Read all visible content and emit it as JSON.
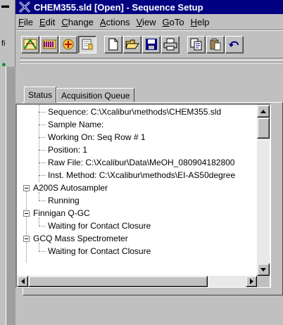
{
  "desktop": {
    "fragments": [
      "fi"
    ]
  },
  "window": {
    "title": "CHEM355.sld [Open] - Sequence Setup",
    "title_color": "#000080"
  },
  "menu": {
    "items": [
      {
        "label": "File",
        "mnemonic": "F"
      },
      {
        "label": "Edit",
        "mnemonic": "E"
      },
      {
        "label": "Change",
        "mnemonic": "C"
      },
      {
        "label": "Actions",
        "mnemonic": "A"
      },
      {
        "label": "View",
        "mnemonic": "V"
      },
      {
        "label": "GoTo",
        "mnemonic": "G"
      },
      {
        "label": "Help",
        "mnemonic": "H"
      }
    ]
  },
  "toolbar": {
    "buttons": [
      {
        "icon": "sequence-grid-icon"
      },
      {
        "icon": "instrument-status-icon"
      },
      {
        "icon": "tune-icon"
      },
      {
        "icon": "info-panel-icon",
        "pressed": true
      },
      {
        "icon": "new-document-icon"
      },
      {
        "icon": "open-folder-icon"
      },
      {
        "icon": "save-disk-icon"
      },
      {
        "icon": "printer-icon"
      },
      {
        "icon": "copy-icon"
      },
      {
        "icon": "paste-icon"
      },
      {
        "icon": "undo-icon"
      }
    ]
  },
  "tabs": {
    "status": "Status",
    "acquisition_queue": "Acquisition Queue"
  },
  "tree": {
    "sequence": "Sequence: C:\\Xcalibur\\methods\\CHEM355.sld",
    "sample_name": "Sample Name:",
    "working_on": "Working On: Seq Row # 1",
    "position": "Position: 1",
    "raw_file": "Raw File: C:\\Xcalibur\\Data\\MeOH_080904182800",
    "inst_method": "Inst. Method: C:\\Xcalibur\\methods\\EI-AS50degree",
    "autosampler": "A200S Autosampler",
    "autosampler_status": "Running",
    "gc": "Finnigan Q-GC",
    "gc_status": "Waiting for Contact Closure",
    "ms": "GCQ Mass Spectrometer",
    "ms_status": "Waiting for Contact Closure"
  }
}
